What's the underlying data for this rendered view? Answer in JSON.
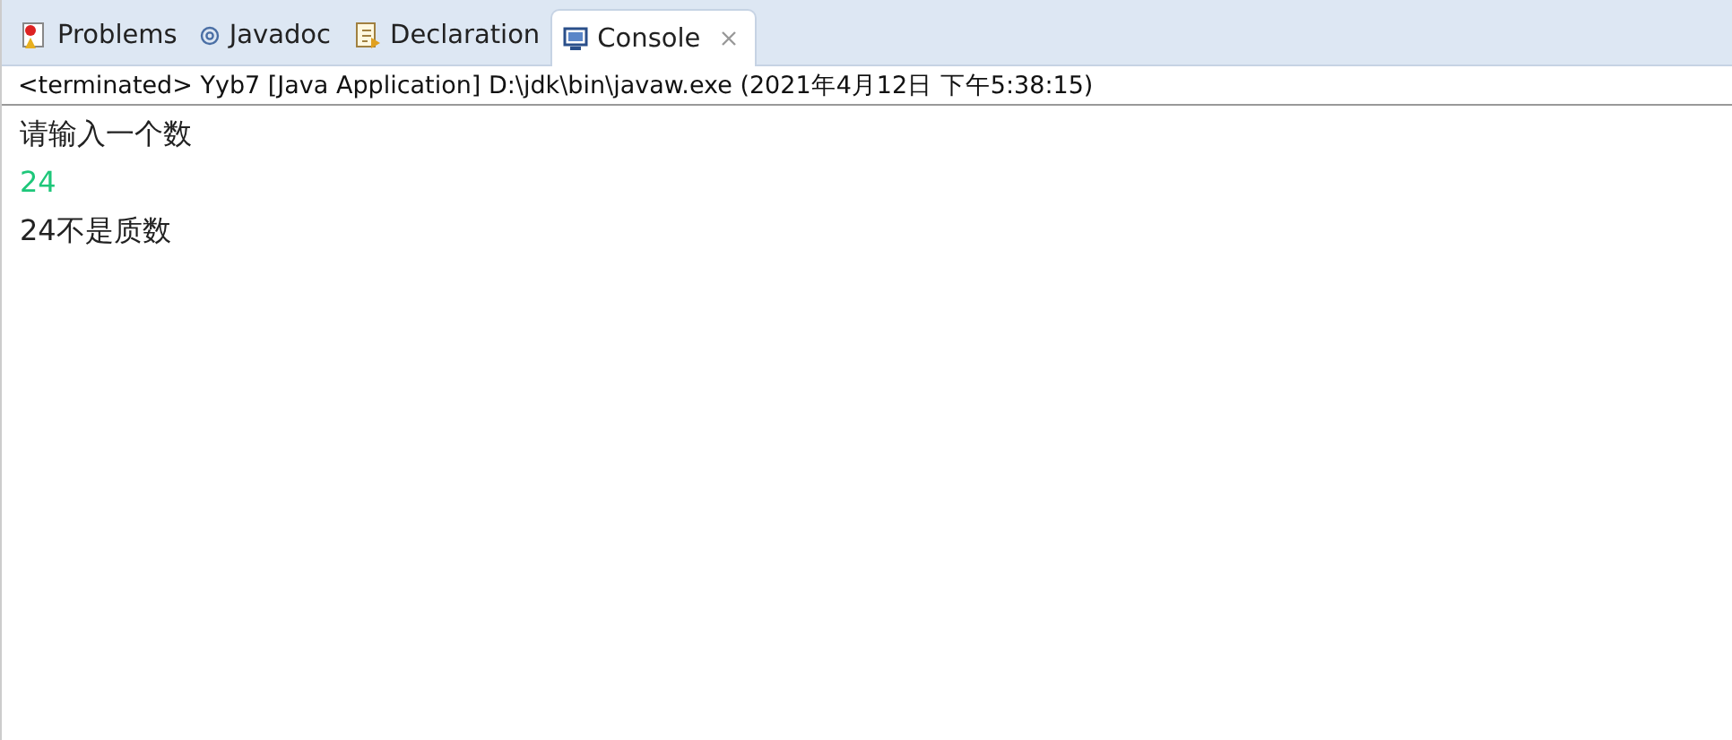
{
  "tabs": [
    {
      "label": "Problems",
      "kind": "problems",
      "selected": false
    },
    {
      "label": "Javadoc",
      "kind": "javadoc",
      "selected": false
    },
    {
      "label": "Declaration",
      "kind": "declaration",
      "selected": false
    },
    {
      "label": "Console",
      "kind": "console",
      "selected": true,
      "closable": true
    }
  ],
  "console": {
    "header": "<terminated> Yyb7 [Java Application] D:\\jdk\\bin\\javaw.exe (2021年4月12日 下午5:38:15)",
    "lines": [
      {
        "kind": "output",
        "text": "请输入一个数"
      },
      {
        "kind": "input",
        "text": "24"
      },
      {
        "kind": "output",
        "text": "24不是质数"
      }
    ]
  }
}
